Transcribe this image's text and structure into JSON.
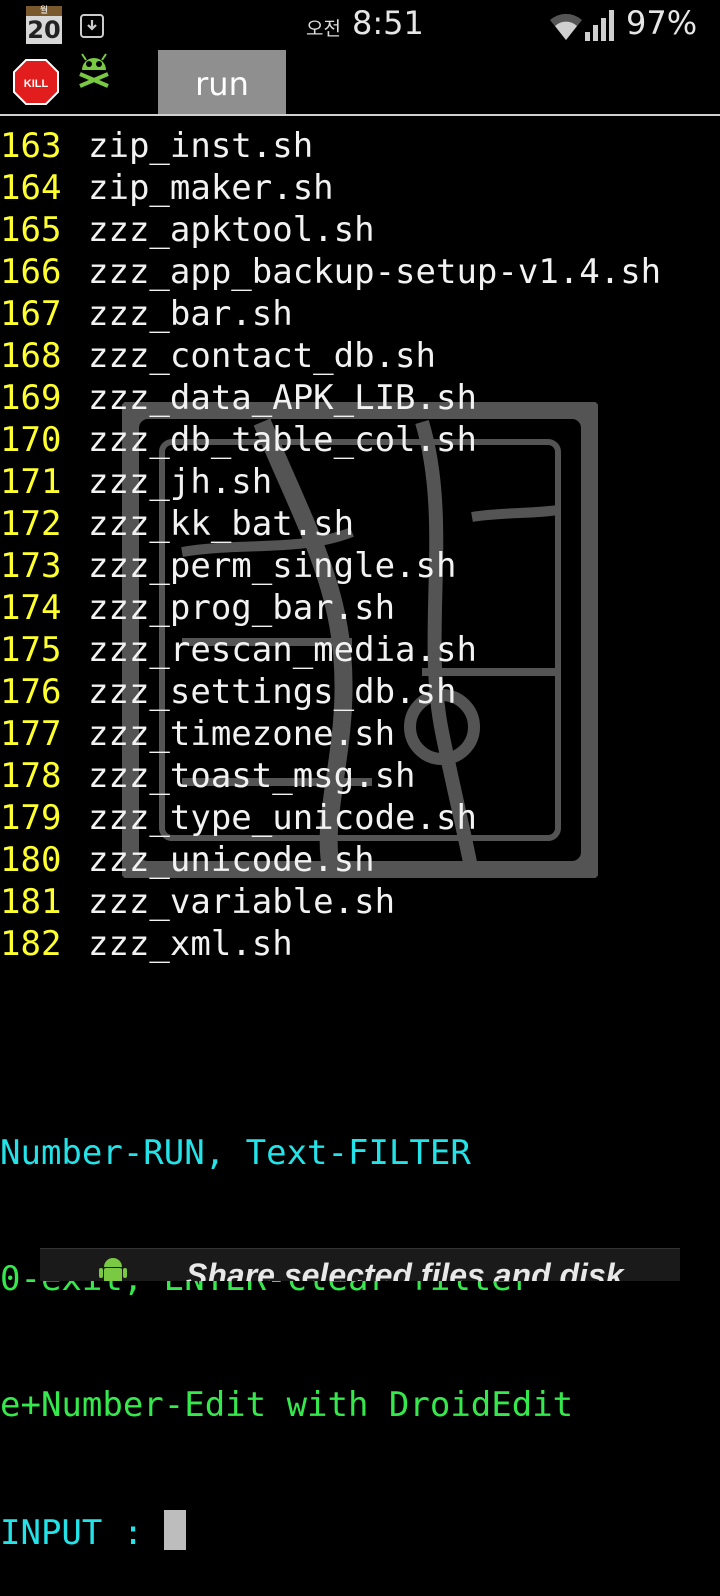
{
  "statusbar": {
    "calendar_month": "월",
    "calendar_day": "20",
    "ampm": "오전",
    "time": "8:51",
    "battery": "97%"
  },
  "toolbar": {
    "kill_label": "KILL",
    "run_tab": "run"
  },
  "listing": [
    {
      "num": "163",
      "name": "zip_inst.sh"
    },
    {
      "num": "164",
      "name": "zip_maker.sh"
    },
    {
      "num": "165",
      "name": "zzz_apktool.sh"
    },
    {
      "num": "166",
      "name": "zzz_app_backup-setup-v1.4.sh"
    },
    {
      "num": "167",
      "name": "zzz_bar.sh"
    },
    {
      "num": "168",
      "name": "zzz_contact_db.sh"
    },
    {
      "num": "169",
      "name": "zzz_data_APK_LIB.sh"
    },
    {
      "num": "170",
      "name": "zzz_db_table_col.sh"
    },
    {
      "num": "171",
      "name": "zzz_jh.sh"
    },
    {
      "num": "172",
      "name": "zzz_kk_bat.sh"
    },
    {
      "num": "173",
      "name": "zzz_perm_single.sh"
    },
    {
      "num": "174",
      "name": "zzz_prog_bar.sh"
    },
    {
      "num": "175",
      "name": "zzz_rescan_media.sh"
    },
    {
      "num": "176",
      "name": "zzz_settings_db.sh"
    },
    {
      "num": "177",
      "name": "zzz_timezone.sh"
    },
    {
      "num": "178",
      "name": "zzz_toast_msg.sh"
    },
    {
      "num": "179",
      "name": "zzz_type_unicode.sh"
    },
    {
      "num": "180",
      "name": "zzz_unicode.sh"
    },
    {
      "num": "181",
      "name": "zzz_variable.sh"
    },
    {
      "num": "182",
      "name": "zzz_xml.sh"
    }
  ],
  "prompt": {
    "line1": "Number-RUN, Text-FILTER",
    "line2": "0-exit, ENTER-clear filter",
    "line3": "e+Number-Edit with DroidEdit",
    "input_label": "INPUT : "
  },
  "banner": {
    "text": "Share selected files and disk"
  },
  "colors": {
    "number": "#ffff2e",
    "filename": "#f2f2f2",
    "cyan": "#23e3e8",
    "green": "#35e84b",
    "tab": "#8f8f8f"
  }
}
